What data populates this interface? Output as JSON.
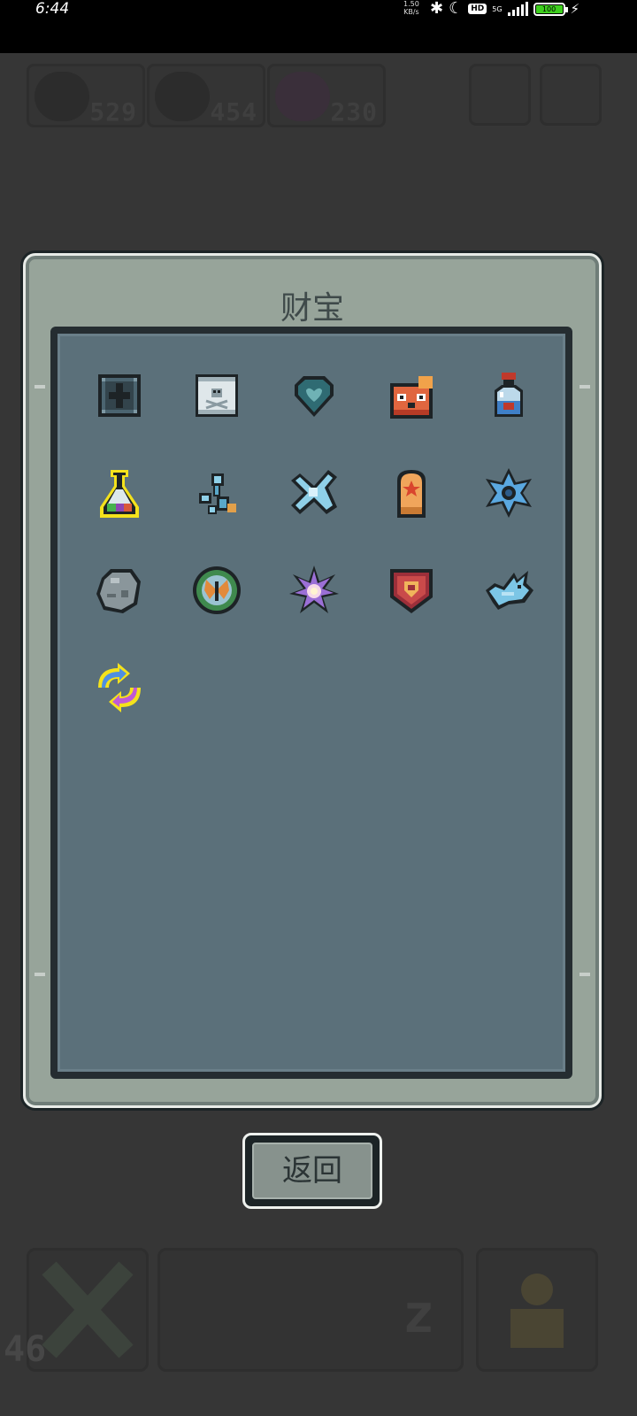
{
  "status_bar": {
    "time": "6:44",
    "net_speed_value": "1.50",
    "net_speed_unit": "KB/s",
    "hd": "HD",
    "network": "5G",
    "battery": "100"
  },
  "background": {
    "resources": [
      {
        "icon": "skull-icon",
        "count": "529"
      },
      {
        "icon": "skull-icon",
        "count": "454"
      },
      {
        "icon": "orb-icon",
        "count": "230"
      }
    ],
    "level": "46"
  },
  "panel": {
    "title": "财宝",
    "items": [
      {
        "icon": "iron-block-icon"
      },
      {
        "icon": "skull-scroll-icon"
      },
      {
        "icon": "heart-gem-icon"
      },
      {
        "icon": "red-panda-icon"
      },
      {
        "icon": "blue-potion-icon"
      },
      {
        "icon": "rainbow-potion-icon",
        "highlighted": true
      },
      {
        "icon": "blue-crystal-pieces-icon"
      },
      {
        "icon": "ice-crystal-icon"
      },
      {
        "icon": "tombstone-icon"
      },
      {
        "icon": "blue-star-icon"
      },
      {
        "icon": "grey-stone-icon"
      },
      {
        "icon": "butterfly-medallion-icon"
      },
      {
        "icon": "purple-flower-icon"
      },
      {
        "icon": "shield-crest-icon"
      },
      {
        "icon": "ice-dragon-icon"
      },
      {
        "icon": "swap-arrows-icon",
        "highlighted": true
      }
    ]
  },
  "return_button": "返回"
}
